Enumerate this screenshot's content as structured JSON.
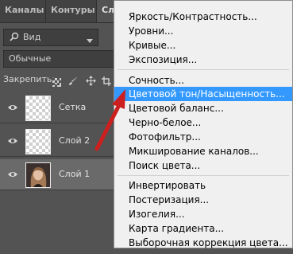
{
  "tabs": [
    "Каналы",
    "Контуры",
    "Сл"
  ],
  "filter": {
    "label": "Вид"
  },
  "blend_mode": "Обычные",
  "lock_label": "Закрепить:",
  "layers": [
    {
      "name": "Сетка",
      "selected": false
    },
    {
      "name": "Слой 2",
      "selected": false
    },
    {
      "name": "Слой 1",
      "selected": true
    }
  ],
  "menu": {
    "groups": [
      [
        "Яркость/Контрастность...",
        "Уровни...",
        "Кривые...",
        "Экспозиция..."
      ],
      [
        "Сочность...",
        "Цветовой тон/Насыщенность...",
        "Цветовой баланс...",
        "Черно-белое...",
        "Фотофильтр...",
        "Микширование каналов...",
        "Поиск цвета..."
      ],
      [
        "Инвертировать",
        "Постеризация...",
        "Изогелия...",
        "Карта градиента...",
        "Выборочная коррекция цвета..."
      ]
    ],
    "highlighted": "Цветовой тон/Насыщенность..."
  },
  "colors": {
    "highlight": "#3399ff",
    "arrow": "#cc1f1f",
    "panel": "#535353"
  }
}
